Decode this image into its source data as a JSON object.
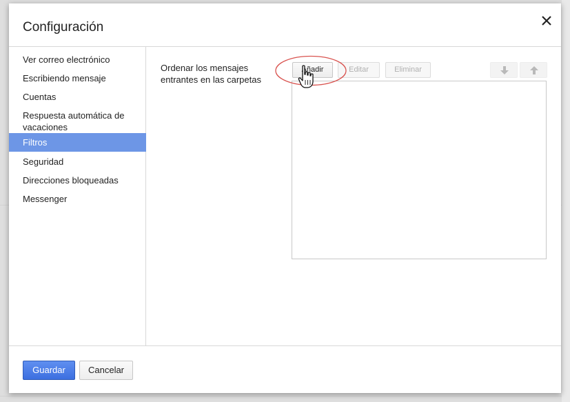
{
  "dialog": {
    "title": "Configuración",
    "close_icon": "close-icon"
  },
  "sidebar": {
    "items": [
      {
        "label": "Ver correo electrónico",
        "active": false
      },
      {
        "label": "Escribiendo mensaje",
        "active": false
      },
      {
        "label": "Cuentas",
        "active": false
      },
      {
        "label": "Respuesta automática de vacaciones",
        "active": false
      },
      {
        "label": "Filtros",
        "active": true
      },
      {
        "label": "Seguridad",
        "active": false
      },
      {
        "label": "Direcciones bloqueadas",
        "active": false
      },
      {
        "label": "Messenger",
        "active": false
      }
    ]
  },
  "filters": {
    "description": "Ordenar los mensajes entrantes en las carpetas",
    "add_label": "Añadir",
    "edit_label": "Editar",
    "delete_label": "Eliminar",
    "move_down_icon": "arrow-down-icon",
    "move_up_icon": "arrow-up-icon",
    "edit_enabled": false,
    "delete_enabled": false
  },
  "footer": {
    "save_label": "Guardar",
    "cancel_label": "Cancelar"
  },
  "colors": {
    "active_nav": "#6d96e6",
    "primary_button": "#4a7be8",
    "highlight_ellipse": "#d9534f"
  }
}
